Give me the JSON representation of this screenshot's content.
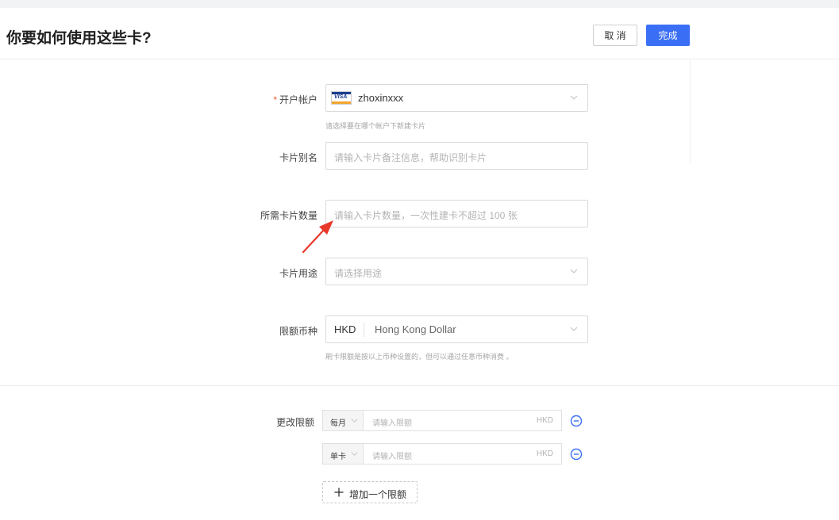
{
  "header": {
    "title": "你要如何使用这些卡?",
    "cancel_label": "取 消",
    "done_label": "完成"
  },
  "form": {
    "account": {
      "required_mark": "*",
      "label": "开户帐户",
      "card_brand": "VISA",
      "value": "zhoxinxxx",
      "hint": "请选择要在哪个帐户下新建卡片"
    },
    "alias": {
      "label": "卡片别名",
      "placeholder": "请输入卡片备注信息，帮助识别卡片"
    },
    "quantity": {
      "label": "所需卡片数量",
      "placeholder": "请输入卡片数量，一次性建卡不超过 100 张"
    },
    "purpose": {
      "label": "卡片用途",
      "placeholder": "请选择用途"
    },
    "currency": {
      "label": "限额币种",
      "code": "HKD",
      "name": "Hong Kong Dollar",
      "hint": "刷卡限额是按以上币种设置的，但可以通过任意币种消费 。"
    }
  },
  "limits": {
    "label": "更改限额",
    "rows": [
      {
        "period": "每月",
        "placeholder": "请输入限额",
        "currency": "HKD"
      },
      {
        "period": "单卡",
        "placeholder": "请输入限额",
        "currency": "HKD"
      }
    ],
    "add_label": "增加一个限额"
  },
  "colors": {
    "primary": "#3a6ff5",
    "required": "#f05a2b",
    "annotation_arrow": "#e8392b"
  },
  "icons": [
    "chevron-down-icon",
    "minus-circle-icon",
    "plus-icon",
    "visa-card-icon",
    "annotation-arrow"
  ]
}
